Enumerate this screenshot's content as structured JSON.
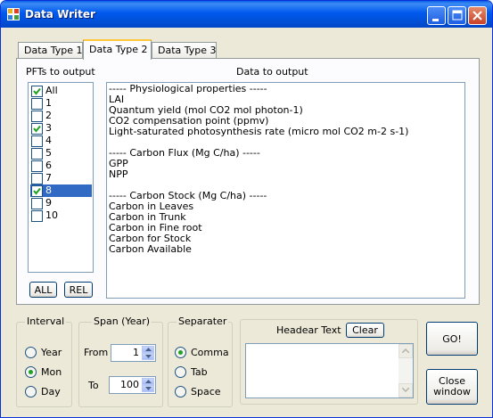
{
  "window": {
    "title": "Data Writer",
    "icon": "app-icon",
    "controls": [
      "minimize-icon",
      "maximize-icon",
      "close-icon"
    ]
  },
  "tabs": [
    {
      "label": "Data Type 1",
      "active": false
    },
    {
      "label": "Data Type 2",
      "active": true
    },
    {
      "label": "Data Type 3",
      "active": false
    }
  ],
  "pft": {
    "header": "PFTs to output",
    "items": [
      {
        "label": "All",
        "checked": true,
        "selected": false
      },
      {
        "label": "1",
        "checked": false,
        "selected": false
      },
      {
        "label": "2",
        "checked": false,
        "selected": false
      },
      {
        "label": "3",
        "checked": true,
        "selected": false
      },
      {
        "label": "4",
        "checked": false,
        "selected": false
      },
      {
        "label": "5",
        "checked": false,
        "selected": false
      },
      {
        "label": "6",
        "checked": false,
        "selected": false
      },
      {
        "label": "7",
        "checked": false,
        "selected": false
      },
      {
        "label": "8",
        "checked": true,
        "selected": true
      },
      {
        "label": "9",
        "checked": false,
        "selected": false
      },
      {
        "label": "10",
        "checked": false,
        "selected": false
      }
    ],
    "all_button": "ALL",
    "rel_button": "REL"
  },
  "output": {
    "header": "Data to output",
    "lines": [
      "----- Physiological properties -----",
      "LAI",
      "Quantum yield (mol CO2 mol photon-1)",
      "CO2 compensation point (ppmv)",
      "Light-saturated photosynthesis rate (micro mol CO2 m-2 s-1)",
      "",
      "----- Carbon Flux (Mg C/ha) -----",
      "GPP",
      "NPP",
      "",
      "----- Carbon Stock (Mg C/ha) -----",
      "Carbon in Leaves",
      "Carbon in Trunk",
      "Carbon in Fine root",
      "Carbon for Stock",
      "Carbon Available"
    ]
  },
  "interval": {
    "title": "Interval",
    "options": [
      {
        "label": "Year",
        "selected": false
      },
      {
        "label": "Mon",
        "selected": true
      },
      {
        "label": "Day",
        "selected": false
      }
    ]
  },
  "span": {
    "title": "Span (Year)",
    "from_label": "From",
    "from_value": "1",
    "to_label": "To",
    "to_value": "100"
  },
  "separater": {
    "title": "Separater",
    "options": [
      {
        "label": "Comma",
        "selected": true
      },
      {
        "label": "Tab",
        "selected": false
      },
      {
        "label": "Space",
        "selected": false
      }
    ]
  },
  "header_text": {
    "title": "Headear Text",
    "clear_button": "Clear",
    "value": ""
  },
  "actions": {
    "go_button": "GO!",
    "close_line1": "Close",
    "close_line2": "window"
  },
  "colors": {
    "titlebar": "#0058ee",
    "selection": "#316ac5",
    "window_bg": "#ece9d8",
    "check": "#21a121"
  }
}
